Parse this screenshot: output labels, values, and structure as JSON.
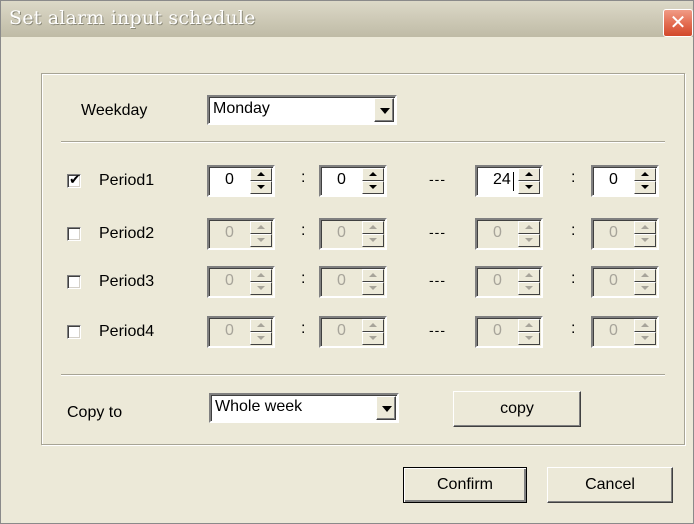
{
  "window": {
    "title": "Set alarm input schedule",
    "close_glyph": "✕"
  },
  "weekday": {
    "label": "Weekday",
    "value": "Monday"
  },
  "periods": [
    {
      "label": "Period1",
      "checked": true,
      "enabled": true,
      "start_hour": "0",
      "start_min": "0",
      "end_hour": "24",
      "end_min": "0"
    },
    {
      "label": "Period2",
      "checked": false,
      "enabled": false,
      "start_hour": "0",
      "start_min": "0",
      "end_hour": "0",
      "end_min": "0"
    },
    {
      "label": "Period3",
      "checked": false,
      "enabled": false,
      "start_hour": "0",
      "start_min": "0",
      "end_hour": "0",
      "end_min": "0"
    },
    {
      "label": "Period4",
      "checked": false,
      "enabled": false,
      "start_hour": "0",
      "start_min": "0",
      "end_hour": "0",
      "end_min": "0"
    }
  ],
  "separators": {
    "colon": ":",
    "dash": "---"
  },
  "copy": {
    "label": "Copy to",
    "value": "Whole week",
    "button_label": "copy"
  },
  "buttons": {
    "confirm": "Confirm",
    "cancel": "Cancel"
  },
  "check_glyph": "✔"
}
